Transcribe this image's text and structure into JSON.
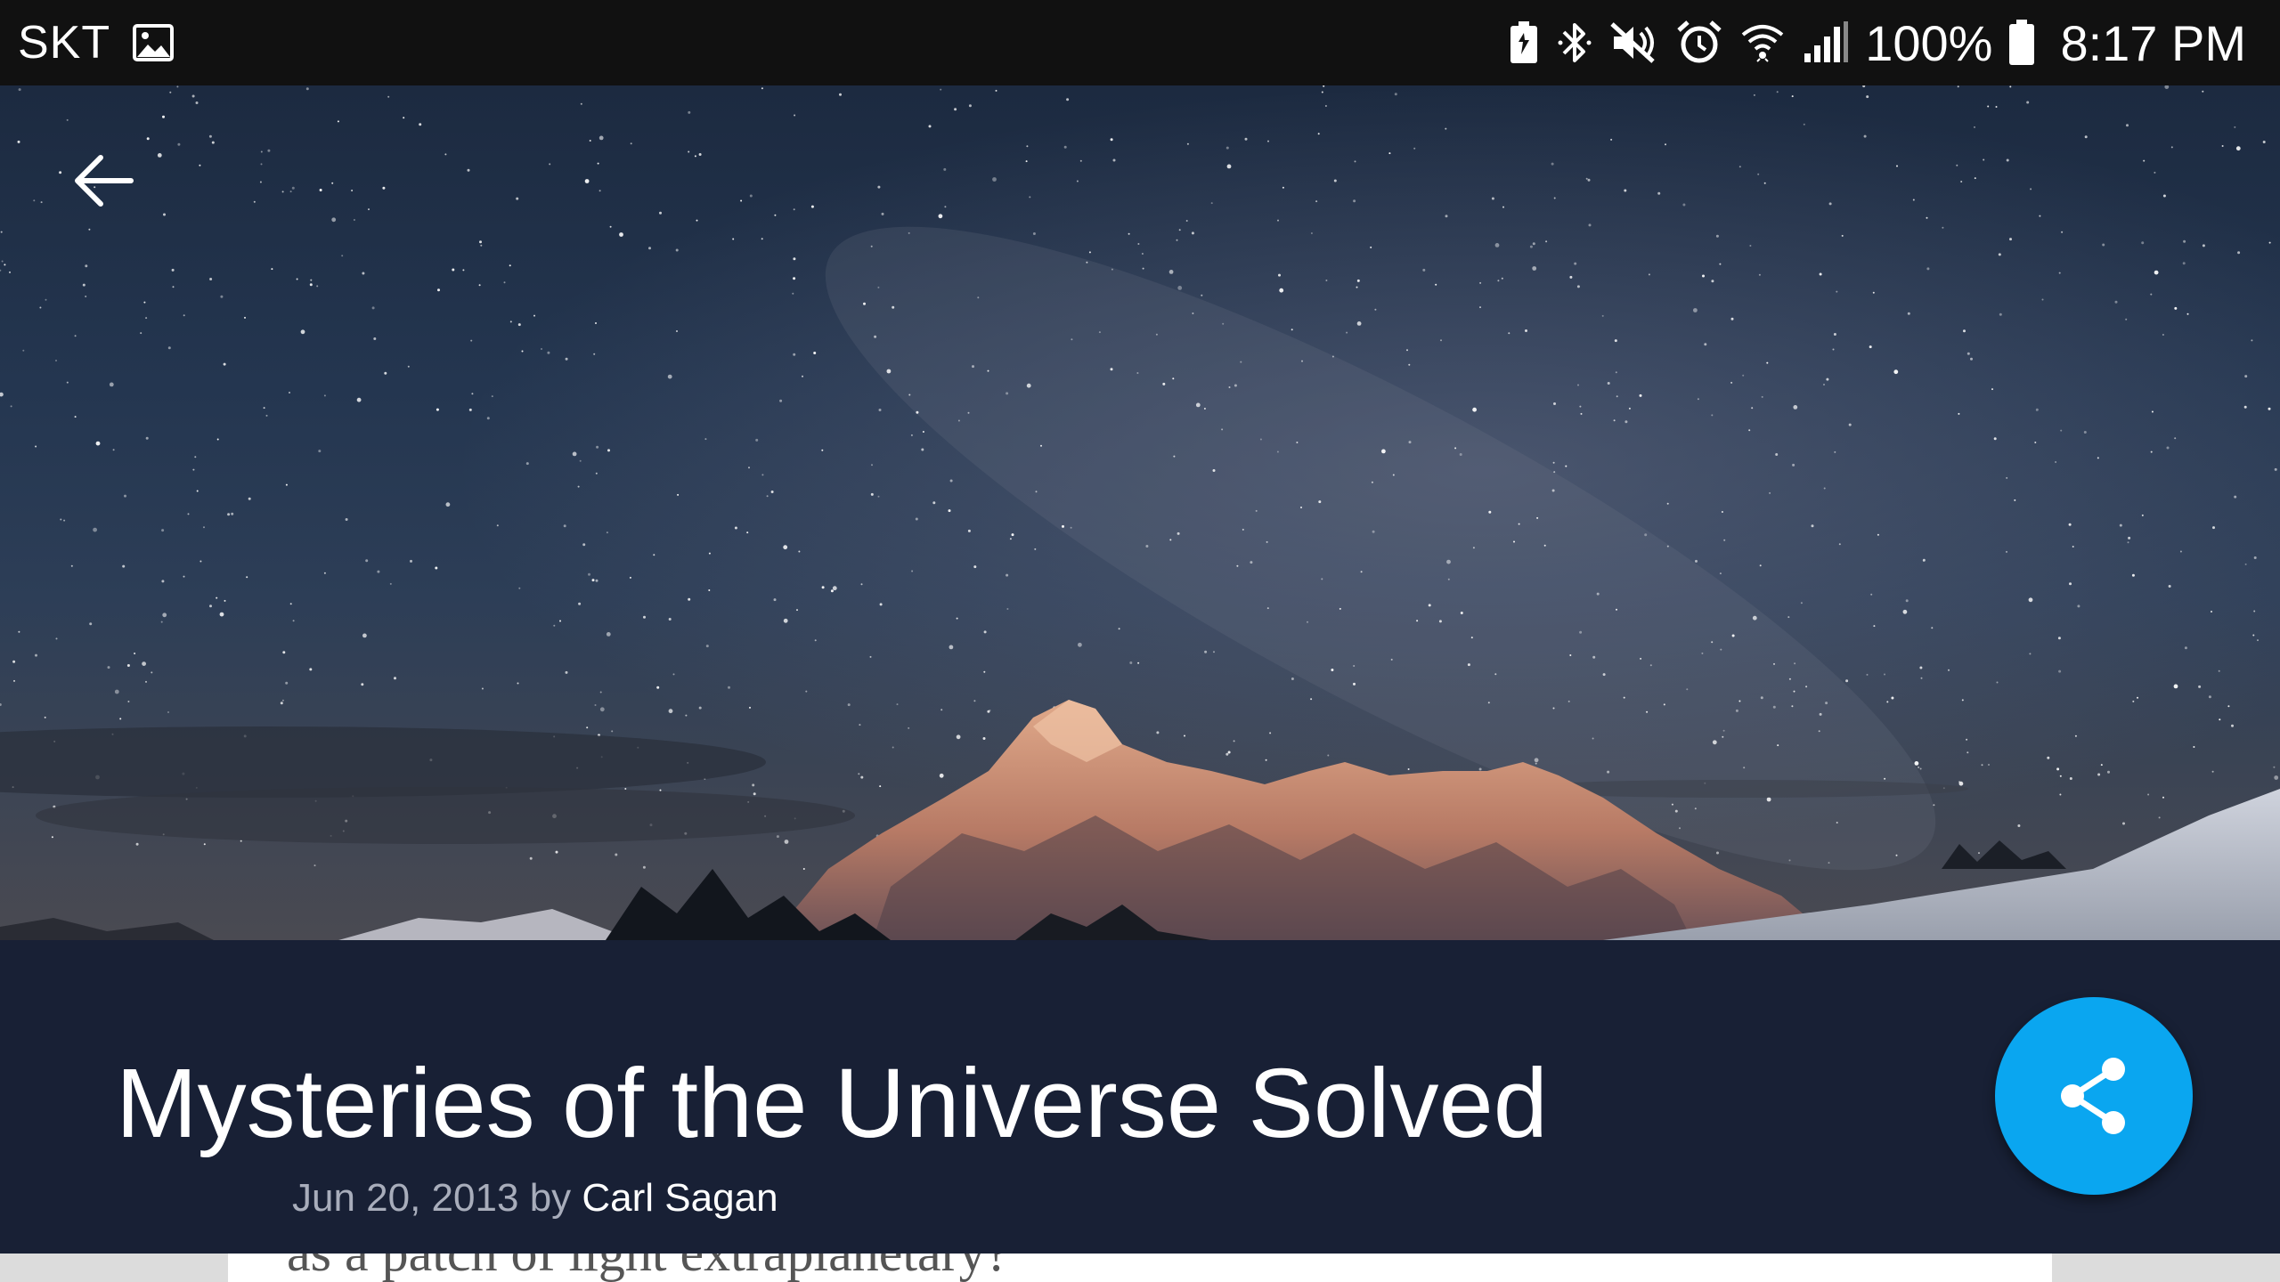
{
  "status_bar": {
    "carrier": "SKT",
    "battery_percent": "100%",
    "time": "8:17 PM",
    "icons": [
      "image-icon",
      "battery-saver-icon",
      "bluetooth-icon",
      "mute-icon",
      "alarm-icon",
      "wifi-icon",
      "signal-icon",
      "battery-icon"
    ]
  },
  "hero": {
    "back_icon": "back-arrow-icon",
    "image": "starry-night-mountain"
  },
  "article": {
    "title": "Mysteries of the Universe Solved",
    "date": "Jun 20, 2013",
    "by": "by",
    "author": "Carl Sagan",
    "body_snippet": "as a patch of light extraplanetary?"
  },
  "share": {
    "icon": "share-icon",
    "color": "#0aa6f0"
  },
  "colors": {
    "status_bar": "#111111",
    "title_panel": "#182035",
    "title_text": "#ffffff",
    "byline_text": "#a8adbb",
    "fab": "#0aa6f0"
  }
}
